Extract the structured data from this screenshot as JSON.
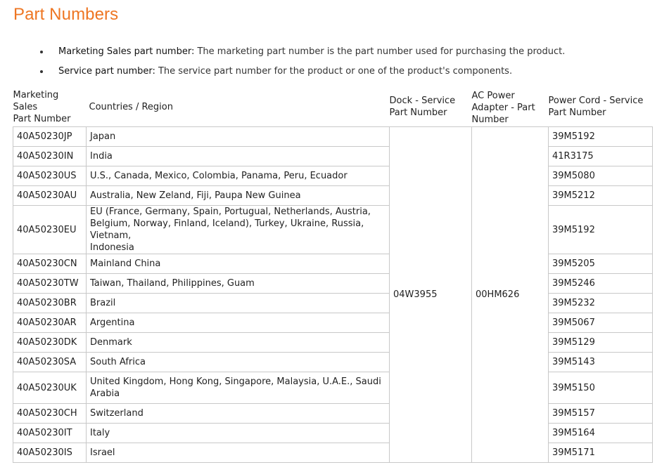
{
  "page_title": "Part Numbers",
  "bullets": [
    {
      "term": "Marketing Sales part number:",
      "desc": " The marketing part number is the part number used for purchasing the product."
    },
    {
      "term": "Service part number:",
      "desc": " The service part number for the product or one of the product's components."
    }
  ],
  "table": {
    "headers": {
      "marketing": [
        "Marketing Sales",
        "Part Number"
      ],
      "countries": "Countries / Region",
      "dock": [
        "Dock - Service",
        "Part Number"
      ],
      "adapter": [
        "AC Power",
        "Adapter - Part",
        "Number"
      ],
      "cord": [
        "Power Cord - Service",
        "Part Number"
      ]
    },
    "dock_service_pn": "04W3955",
    "ac_adapter_pn": "00HM626",
    "rows": [
      {
        "mpn": "40A50230JP",
        "region": "Japan",
        "cord": "39M5192"
      },
      {
        "mpn": "40A50230IN",
        "region": "India",
        "cord": "41R3175"
      },
      {
        "mpn": "40A50230US",
        "region": "U.S., Canada, Mexico, Colombia, Panama, Peru, Ecuador",
        "cord": "39M5080"
      },
      {
        "mpn": "40A50230AU",
        "region": "Australia, New Zeland, Fiji, Paupa New Guinea",
        "cord": "39M5212"
      },
      {
        "mpn": "40A50230EU",
        "region_lines": [
          "EU (France, Germany, Spain, Portugual, Netherlands, Austria,",
          "Belgium, Norway, Finland, Iceland), Turkey, Ukraine, Russia, Vietnam,",
          "Indonesia"
        ],
        "cord": "39M5192"
      },
      {
        "mpn": "40A50230CN",
        "region": "Mainland China",
        "cord": "39M5205"
      },
      {
        "mpn": "40A50230TW",
        "region": "Taiwan, Thailand, Philippines, Guam",
        "cord": "39M5246"
      },
      {
        "mpn": "40A50230BR",
        "region": "Brazil",
        "cord": "39M5232"
      },
      {
        "mpn": "40A50230AR",
        "region": "Argentina",
        "cord": "39M5067"
      },
      {
        "mpn": "40A50230DK",
        "region": "Denmark",
        "cord": "39M5129"
      },
      {
        "mpn": "40A50230SA",
        "region": "South Africa",
        "cord": "39M5143"
      },
      {
        "mpn": "40A50230UK",
        "region_lines": [
          "United Kingdom, Hong Kong, Singapore, Malaysia, U.A.E., Saudi",
          "Arabia"
        ],
        "cord": "39M5150"
      },
      {
        "mpn": "40A50230CH",
        "region": "Switzerland",
        "cord": "39M5157"
      },
      {
        "mpn": "40A50230IT",
        "region": "Italy",
        "cord": "39M5164"
      },
      {
        "mpn": "40A50230IS",
        "region": "Israel",
        "cord": "39M5171"
      }
    ]
  }
}
